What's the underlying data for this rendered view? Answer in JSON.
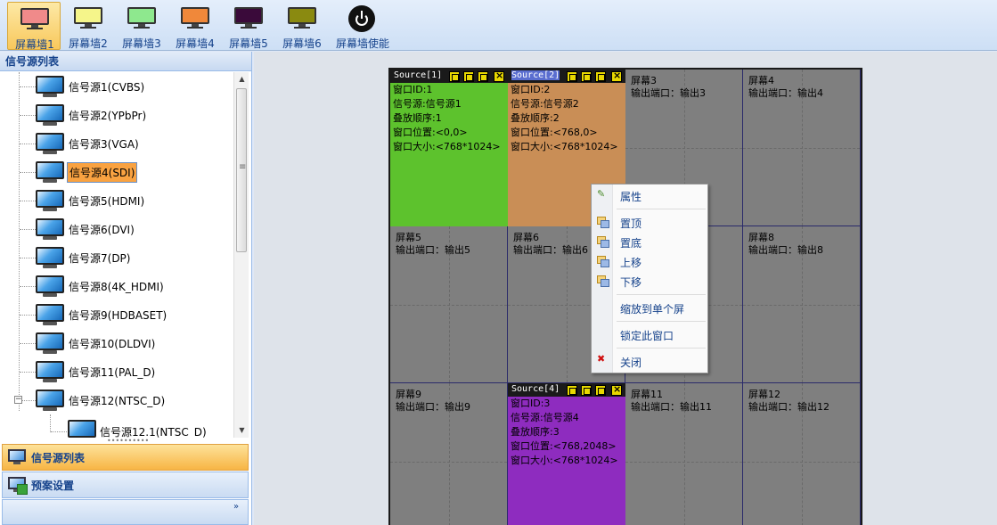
{
  "toolbar": {
    "buttons": [
      {
        "label": "屏幕墙1",
        "color": "#f08a8a"
      },
      {
        "label": "屏幕墙2",
        "color": "#f5f58a"
      },
      {
        "label": "屏幕墙3",
        "color": "#8ee88e"
      },
      {
        "label": "屏幕墙4",
        "color": "#f0883a"
      },
      {
        "label": "屏幕墙5",
        "color": "#3a0a3a"
      },
      {
        "label": "屏幕墙6",
        "color": "#8a8a10"
      }
    ],
    "enable_label": "屏幕墙使能",
    "active_index": 0
  },
  "left_panel": {
    "title": "信号源列表",
    "sources": [
      "信号源1(CVBS)",
      "信号源2(YPbPr)",
      "信号源3(VGA)",
      "信号源4(SDI)",
      "信号源5(HDMI)",
      "信号源6(DVI)",
      "信号源7(DP)",
      "信号源8(4K_HDMI)",
      "信号源9(HDBASET)",
      "信号源10(DLDVI)",
      "信号源11(PAL_D)",
      "信号源12(NTSC_D)"
    ],
    "sub_source": "信号源12.1(NTSC_D)",
    "selected_index": 3,
    "expander_symbol": "−",
    "nav": {
      "signal_list": "信号源列表",
      "preset": "预案设置"
    }
  },
  "wall": {
    "screens": [
      {
        "name": "屏幕3",
        "port": "输出端口：输出3"
      },
      {
        "name": "屏幕4",
        "port": "输出端口：输出4"
      },
      {
        "name": "屏幕5",
        "port": "输出端口：输出5"
      },
      {
        "name": "屏幕6",
        "port": "输出端口：输出6"
      },
      {
        "name": "屏幕8",
        "port": "输出端口：输出8"
      },
      {
        "name": "屏幕9",
        "port": "输出端口：输出9"
      },
      {
        "name": "屏幕11",
        "port": "输出端口：输出11"
      },
      {
        "name": "屏幕12",
        "port": "输出端口：输出12"
      }
    ],
    "windows": [
      {
        "title": "Source[1]",
        "color": "#5dc22d",
        "lines": [
          "窗口ID:1",
          "信号源:信号源1",
          "叠放顺序:1",
          "窗口位置:<0,0>",
          "窗口大小:<768*1024>"
        ]
      },
      {
        "title": "Source[2]",
        "color": "#c98e56",
        "lines": [
          "窗口ID:2",
          "信号源:信号源2",
          "叠放顺序:2",
          "窗口位置:<768,0>",
          "窗口大小:<768*1024>"
        ]
      },
      {
        "title": "Source[4]",
        "color": "#8e2cbf",
        "lines": [
          "窗口ID:3",
          "信号源:信号源4",
          "叠放顺序:3",
          "窗口位置:<768,2048>",
          "窗口大小:<768*1024>"
        ]
      }
    ]
  },
  "context_menu": {
    "properties": "属性",
    "to_top": "置顶",
    "to_bottom": "置底",
    "move_up": "上移",
    "move_down": "下移",
    "fit_single_screen": "缩放到单个屏",
    "lock_window": "锁定此窗口",
    "close": "关闭"
  }
}
